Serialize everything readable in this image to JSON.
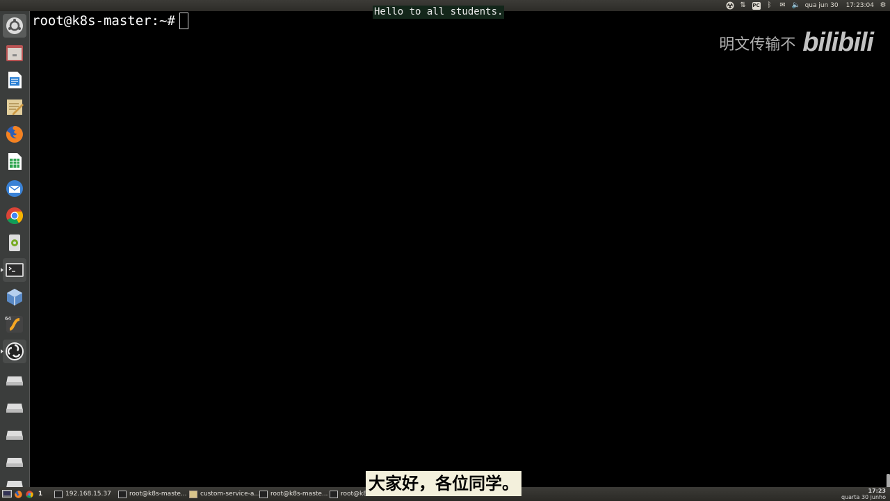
{
  "top_panel": {
    "date": "qua jun 30",
    "time": "17:23:04",
    "indicators": [
      "obs-icon",
      "network-icon",
      "pc-indicator-icon",
      "bluetooth-icon",
      "mail-icon",
      "volume-icon",
      "session-gear-icon"
    ],
    "pc_label": "PC"
  },
  "launcher": {
    "items": [
      {
        "name": "launcher-dash-icon"
      },
      {
        "name": "launcher-files-icon"
      },
      {
        "name": "launcher-writer-icon"
      },
      {
        "name": "launcher-text-editor-icon"
      },
      {
        "name": "launcher-firefox-icon"
      },
      {
        "name": "launcher-calc-icon"
      },
      {
        "name": "launcher-mail-icon"
      },
      {
        "name": "launcher-chrome-icon"
      },
      {
        "name": "launcher-disk-icon"
      },
      {
        "name": "launcher-terminal-icon"
      },
      {
        "name": "launcher-virtualbox-icon"
      },
      {
        "name": "launcher-sublime-icon",
        "badge": "64"
      },
      {
        "name": "launcher-obs-icon"
      },
      {
        "name": "launcher-drive-icon"
      },
      {
        "name": "launcher-drive-icon"
      },
      {
        "name": "launcher-drive-icon"
      },
      {
        "name": "launcher-drive-icon"
      },
      {
        "name": "launcher-drive-icon"
      }
    ]
  },
  "terminal": {
    "prompt": "root@k8s-master:~#"
  },
  "subtitle_en": "Hello to all students.",
  "subtitle_zh": "大家好，各位同学。",
  "watermark": {
    "text": "明文传输不",
    "logo": "bilibili"
  },
  "taskbar": {
    "workspace": "1",
    "tasks": [
      {
        "label": "192.168.15.37",
        "icon": "remote-icon"
      },
      {
        "label": "root@k8s-maste...",
        "icon": "terminal-icon"
      },
      {
        "label": "custom-service-a...",
        "icon": "text-editor-icon"
      },
      {
        "label": "root@k8s-maste...",
        "icon": "terminal-icon"
      },
      {
        "label": "root@k8s",
        "icon": "terminal-icon"
      }
    ],
    "clock_time": "17:23",
    "clock_date": "quarta 30 junho"
  }
}
